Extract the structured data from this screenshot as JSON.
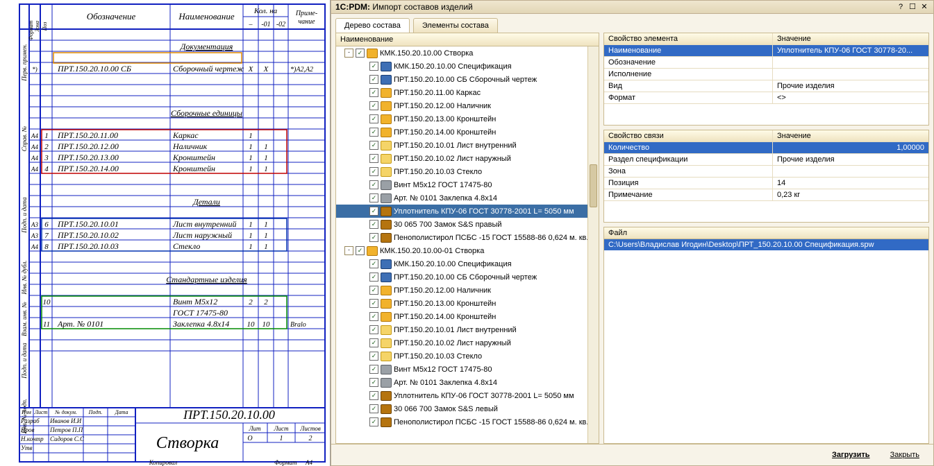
{
  "title_prefix": "1С:PDM:",
  "title": "Импорт составов изделий",
  "win": {
    "help": "?",
    "min": "☐",
    "close": "✕"
  },
  "tabs": {
    "tree": "Дерево состава",
    "elem": "Элементы состава"
  },
  "tree_header": "Наименование",
  "tree": [
    {
      "d": 0,
      "t": "toggle",
      "exp": "-"
    },
    {
      "d": 0,
      "ico": "pkg",
      "label": "КМК.150.20.10.00 Створка"
    },
    {
      "d": 2,
      "ico": "doc",
      "label": "КМК.150.20.10.00 Спецификация"
    },
    {
      "d": 2,
      "ico": "doc",
      "label": "ПРТ.150.20.10.00 СБ Сборочный чертеж"
    },
    {
      "d": 2,
      "ico": "pkg",
      "label": "ПРТ.150.20.11.00 Каркас"
    },
    {
      "d": 2,
      "ico": "pkg",
      "label": "ПРТ.150.20.12.00 Наличник"
    },
    {
      "d": 2,
      "ico": "pkg",
      "label": "ПРТ.150.20.13.00 Кронштейн"
    },
    {
      "d": 2,
      "ico": "pkg",
      "label": "ПРТ.150.20.14.00 Кронштейн"
    },
    {
      "d": 2,
      "ico": "part",
      "label": "ПРТ.150.20.10.01 Лист внутренний"
    },
    {
      "d": 2,
      "ico": "part",
      "label": "ПРТ.150.20.10.02 Лист наружный"
    },
    {
      "d": 2,
      "ico": "part",
      "label": "ПРТ.150.20.10.03 Стекло"
    },
    {
      "d": 2,
      "ico": "std",
      "label": "Винт М5х12 ГОСТ 17475-80"
    },
    {
      "d": 2,
      "ico": "std",
      "label": "Арт. № 0101 Заклепка 4.8х14"
    },
    {
      "d": 2,
      "ico": "oth",
      "label": "Уплотнитель КПУ-06 ГОСТ 30778-2001 L= 5050 мм",
      "sel": true
    },
    {
      "d": 2,
      "ico": "oth",
      "label": "30 065 700 Замок S&S правый"
    },
    {
      "d": 2,
      "ico": "oth",
      "label": "Пенополистирол ПСБС -15 ГОСТ 15588-86 0,624 м. кв."
    },
    {
      "d": 0,
      "t": "toggle",
      "exp": "-"
    },
    {
      "d": 0,
      "ico": "pkg",
      "label": "КМК.150.20.10.00-01 Створка"
    },
    {
      "d": 2,
      "ico": "doc",
      "label": "КМК.150.20.10.00 Спецификация"
    },
    {
      "d": 2,
      "ico": "doc",
      "label": "ПРТ.150.20.10.00 СБ Сборочный чертеж"
    },
    {
      "d": 2,
      "ico": "pkg",
      "label": "ПРТ.150.20.12.00 Наличник"
    },
    {
      "d": 2,
      "ico": "pkg",
      "label": "ПРТ.150.20.13.00 Кронштейн"
    },
    {
      "d": 2,
      "ico": "pkg",
      "label": "ПРТ.150.20.14.00 Кронштейн"
    },
    {
      "d": 2,
      "ico": "part",
      "label": "ПРТ.150.20.10.01 Лист внутренний"
    },
    {
      "d": 2,
      "ico": "part",
      "label": "ПРТ.150.20.10.02 Лист наружный"
    },
    {
      "d": 2,
      "ico": "part",
      "label": "ПРТ.150.20.10.03 Стекло"
    },
    {
      "d": 2,
      "ico": "std",
      "label": "Винт М5х12 ГОСТ 17475-80"
    },
    {
      "d": 2,
      "ico": "std",
      "label": "Арт. № 0101 Заклепка 4.8х14"
    },
    {
      "d": 2,
      "ico": "oth",
      "label": "Уплотнитель КПУ-06 ГОСТ 30778-2001 L= 5050 мм"
    },
    {
      "d": 2,
      "ico": "oth",
      "label": "30 066 700 Замок S&S левый"
    },
    {
      "d": 2,
      "ico": "oth",
      "label": "Пенополистирол ПСБС -15 ГОСТ 15588-86 0,624 м. кв."
    }
  ],
  "prop_elem_hdr": {
    "k": "Свойство элемента",
    "v": "Значение"
  },
  "prop_elem": [
    {
      "k": "Наименование",
      "v": "Уплотнитель КПУ-06 ГОСТ 30778-20...",
      "sel": true
    },
    {
      "k": "Обозначение",
      "v": ""
    },
    {
      "k": "Исполнение",
      "v": ""
    },
    {
      "k": "Вид",
      "v": "Прочие изделия"
    },
    {
      "k": "Формат",
      "v": "<>"
    }
  ],
  "prop_link_hdr": {
    "k": "Свойство связи",
    "v": "Значение"
  },
  "prop_link": [
    {
      "k": "Количество",
      "v": "1,00000",
      "sel": true,
      "r": true
    },
    {
      "k": "Раздел спецификации",
      "v": "Прочие изделия"
    },
    {
      "k": "Зона",
      "v": ""
    },
    {
      "k": "Позиция",
      "v": "14"
    },
    {
      "k": "Примечание",
      "v": "0,23 кг"
    }
  ],
  "file_hdr": "Файл",
  "file_path": "C:\\Users\\Владислав Игодин\\Desktop\\ПРТ_150.20.10.00   Спецификация.spw",
  "footer": {
    "load": "Загрузить",
    "close": "Закрыть"
  },
  "spec": {
    "hdr": {
      "oboz": "Обозначение",
      "nam": "Наименование",
      "kol": "Кол. на",
      "prim": "Приме-\nчание",
      "dash": "–",
      "c01": "-01",
      "c02": "-02",
      "format": "Формат",
      "zona": "Зона",
      "poz": "Поз"
    },
    "sections": {
      "doc": "Документация",
      "asm": "Сборочные единицы",
      "det": "Детали",
      "std": "Стандартные изделия"
    },
    "rows": {
      "doc": [
        {
          "f": "*)",
          "oboz": "ПРТ.150.20.10.00 СБ",
          "nam": "Сборочный чертеж",
          "c0": "Х",
          "c1": "Х",
          "prim": "*)А2,А2"
        }
      ],
      "asm": [
        {
          "f": "А4",
          "poz": "1",
          "oboz": "ПРТ.150.20.11.00",
          "nam": "Каркас",
          "c0": "1",
          "c1": ""
        },
        {
          "f": "А4",
          "poz": "2",
          "oboz": "ПРТ.150.20.12.00",
          "nam": "Наличник",
          "c0": "1",
          "c1": "1"
        },
        {
          "f": "А4",
          "poz": "3",
          "oboz": "ПРТ.150.20.13.00",
          "nam": "Кронштейн",
          "c0": "1",
          "c1": "1"
        },
        {
          "f": "А4",
          "poz": "4",
          "oboz": "ПРТ.150.20.14.00",
          "nam": "Кронштейн",
          "c0": "1",
          "c1": "1"
        }
      ],
      "det": [
        {
          "f": "А3",
          "poz": "6",
          "oboz": "ПРТ.150.20.10.01",
          "nam": "Лист внутренний",
          "c0": "1",
          "c1": "1"
        },
        {
          "f": "А3",
          "poz": "7",
          "oboz": "ПРТ.150.20.10.02",
          "nam": "Лист наружный",
          "c0": "1",
          "c1": "1"
        },
        {
          "f": "А4",
          "poz": "8",
          "oboz": "ПРТ.150.20.10.03",
          "nam": "Стекло",
          "c0": "1",
          "c1": "1"
        }
      ],
      "std": [
        {
          "poz": "10",
          "oboz": "",
          "nam": "Винт М5х12",
          "c0": "2",
          "c1": "2"
        },
        {
          "poz": "",
          "oboz": "",
          "nam": "ГОСТ 17475-80",
          "c0": "",
          "c1": ""
        },
        {
          "poz": "11",
          "oboz": "Арт. № 0101",
          "nam": "Заклепка 4.8х14",
          "c0": "10",
          "c1": "10",
          "prim": "Bralo"
        }
      ]
    },
    "stamp": {
      "code": "ПРТ.150.20.10.00",
      "name": "Створка",
      "cols": [
        "Изм",
        "Лист",
        "№ докум.",
        "Подп.",
        "Дата"
      ],
      "roles": [
        "Разраб",
        "Пров",
        "Н.контр",
        "Утв"
      ],
      "names": [
        "Иванов И.И",
        "Петров П.П",
        "Сидоров С.С",
        ""
      ],
      "lit": "Лит",
      "list": "Лист",
      "listov": "Листов",
      "list_n": "1",
      "listov_n": "2",
      "lit_v": "О",
      "copy": "Копировал",
      "fmt": "Формат",
      "a4": "А4"
    },
    "side": [
      "Перв. примен.",
      "Справ. №",
      "Подп. и дата",
      "Инв. № дубл.",
      "Взам. инв. №",
      "Подп. и дата",
      "Инв. № подп."
    ]
  }
}
